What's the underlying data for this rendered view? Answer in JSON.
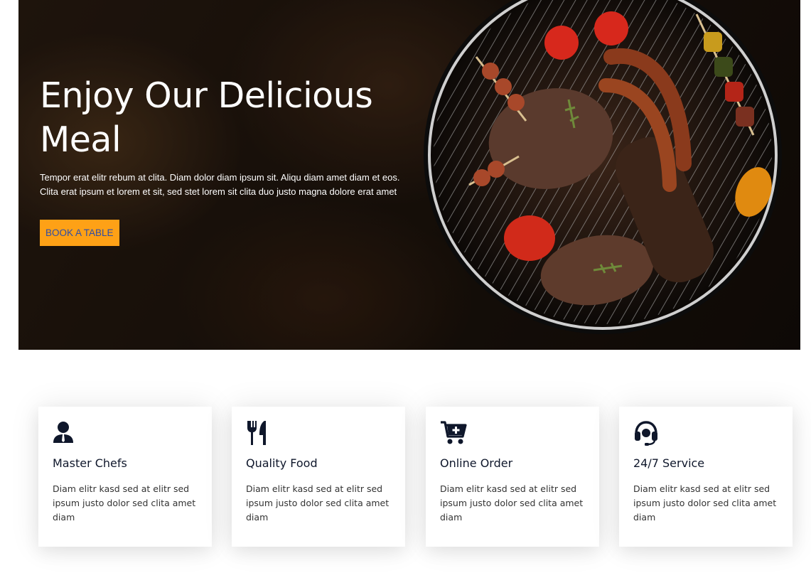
{
  "hero": {
    "title": "Enjoy Our Delicious Meal",
    "description": "Tempor erat elitr rebum at clita. Diam dolor diam ipsum sit. Aliqu diam amet diam et eos. Clita erat ipsum et lorem et sit, sed stet lorem sit clita duo justo magna dolore erat amet",
    "button_label": "BOOK A TABLE",
    "accent_color": "#fea116"
  },
  "services": [
    {
      "icon": "chef-icon",
      "title": "Master Chefs",
      "text": "Diam elitr kasd sed at elitr sed ipsum justo dolor sed clita amet diam"
    },
    {
      "icon": "utensils-icon",
      "title": "Quality Food",
      "text": "Diam elitr kasd sed at elitr sed ipsum justo dolor sed clita amet diam"
    },
    {
      "icon": "cart-plus-icon",
      "title": "Online Order",
      "text": "Diam elitr kasd sed at elitr sed ipsum justo dolor sed clita amet diam"
    },
    {
      "icon": "headset-icon",
      "title": "24/7 Service",
      "text": "Diam elitr kasd sed at elitr sed ipsum justo dolor sed clita amet diam"
    }
  ]
}
